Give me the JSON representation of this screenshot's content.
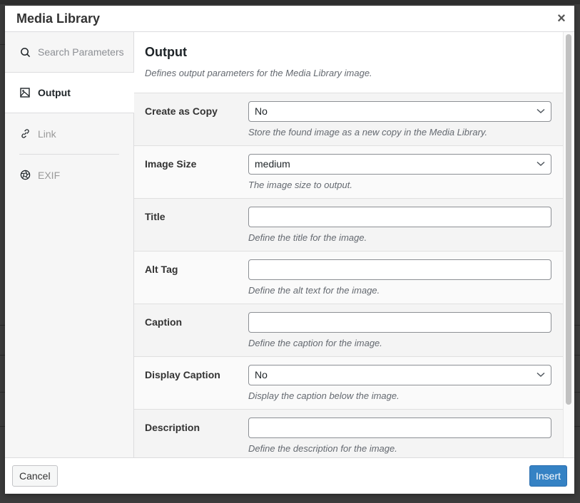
{
  "modal": {
    "title": "Media Library",
    "close_label": "×"
  },
  "sidebar": {
    "search_placeholder": "Search Parameters",
    "items": [
      {
        "label": "Output",
        "icon": "image-icon",
        "active": true
      },
      {
        "label": "Link",
        "icon": "link-icon",
        "active": false
      },
      {
        "label": "EXIF",
        "icon": "aperture-icon",
        "active": false
      }
    ]
  },
  "section": {
    "title": "Output",
    "description": "Defines output parameters for the Media Library image."
  },
  "fields": [
    {
      "label": "Create as Copy",
      "type": "select",
      "value": "No",
      "help": "Store the found image as a new copy in the Media Library."
    },
    {
      "label": "Image Size",
      "type": "select",
      "value": "medium",
      "help": "The image size to output."
    },
    {
      "label": "Title",
      "type": "text",
      "value": "",
      "help": "Define the title for the image."
    },
    {
      "label": "Alt Tag",
      "type": "text",
      "value": "",
      "help": "Define the alt text for the image."
    },
    {
      "label": "Caption",
      "type": "text",
      "value": "",
      "help": "Define the caption for the image."
    },
    {
      "label": "Display Caption",
      "type": "select",
      "value": "No",
      "help": "Display the caption below the image."
    },
    {
      "label": "Description",
      "type": "text",
      "value": "",
      "help": "Define the description for the image."
    }
  ],
  "footer": {
    "cancel_label": "Cancel",
    "insert_label": "Insert"
  },
  "colors": {
    "primary": "#3582c4",
    "sidebar_bg": "#f6f6f6"
  }
}
